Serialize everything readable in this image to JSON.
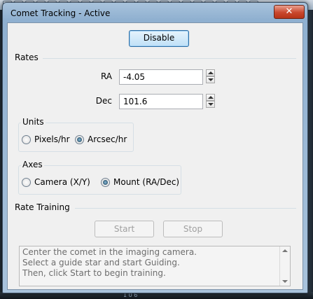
{
  "window": {
    "title": "Comet Tracking - Active",
    "close_glyph": "✕"
  },
  "toolbar": {
    "disable_label": "Disable"
  },
  "rates": {
    "section_label": "Rates",
    "ra_label": "RA",
    "ra_value": "-4.05",
    "dec_label": "Dec",
    "dec_value": "101.6"
  },
  "units": {
    "group_label": "Units",
    "options": [
      {
        "label": "Pixels/hr",
        "checked": false
      },
      {
        "label": "Arcsec/hr",
        "checked": true
      }
    ]
  },
  "axes": {
    "group_label": "Axes",
    "options": [
      {
        "label": "Camera (X/Y)",
        "checked": false
      },
      {
        "label": "Mount (RA/Dec)",
        "checked": true
      }
    ]
  },
  "training": {
    "section_label": "Rate Training",
    "start_label": "Start",
    "stop_label": "Stop",
    "instructions": [
      "Center the comet in the imaging camera.",
      "Select a guide star and start Guiding.",
      "Then, click Start to begin training."
    ]
  },
  "background": {
    "ruler_text": "1 0 6"
  },
  "colors": {
    "titlebar": "#a9c3dc",
    "close_button": "#c9472d",
    "client_bg": "#f0f0f0"
  }
}
